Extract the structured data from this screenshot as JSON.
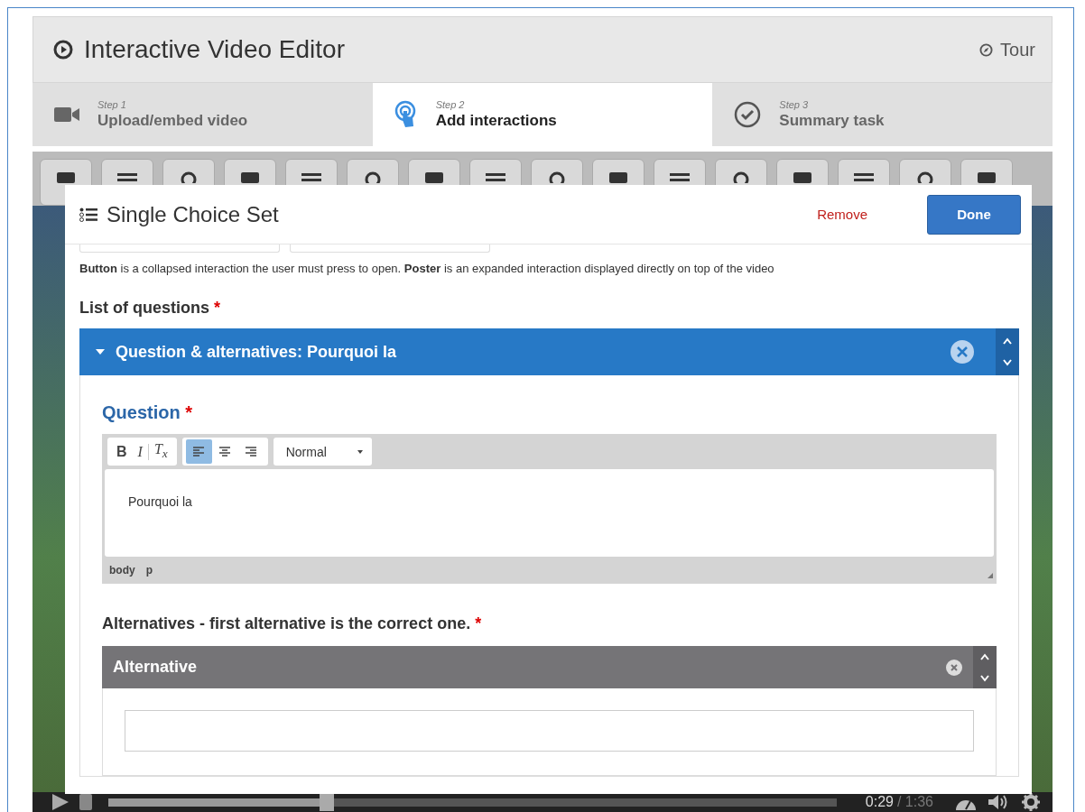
{
  "editor": {
    "title": "Interactive Video Editor",
    "tour": "Tour"
  },
  "steps": [
    {
      "step": "Step 1",
      "label": "Upload/embed video",
      "kind": "video",
      "selected": false
    },
    {
      "step": "Step 2",
      "label": "Add interactions",
      "kind": "interactions",
      "selected": true
    },
    {
      "step": "Step 3",
      "label": "Summary task",
      "kind": "summary",
      "selected": false
    }
  ],
  "dialog": {
    "title": "Single Choice Set",
    "remove": "Remove",
    "done": "Done",
    "description": "**Button** is a collapsed interaction the user must press to open. **Poster** is an expanded interaction displayed directly on top of the video",
    "list_label": {
      "text": "List of questions",
      "required": "*"
    },
    "group": {
      "title": "Question & alternatives: Pourquoi la",
      "expanded": true,
      "question_label": {
        "text": "Question",
        "required": "*"
      },
      "format_buttons": [
        "B",
        "I",
        "T$_{x}$"
      ],
      "align_buttons": [
        {
          "kind": "left",
          "selected": true
        },
        {
          "kind": "center",
          "selected": false
        },
        {
          "kind": "right",
          "selected": false
        }
      ],
      "format_select": "Normal",
      "question_text": "Pourquoi la",
      "path": [
        "body",
        "p"
      ],
      "alternatives_label": {
        "text": "Alternatives - first alternative is the correct one.",
        "required": "*"
      },
      "alternative": {
        "title": "Alternative"
      }
    }
  },
  "player": {
    "level": 0.3,
    "time": "0:29",
    "duration": "/ 1:36"
  }
}
